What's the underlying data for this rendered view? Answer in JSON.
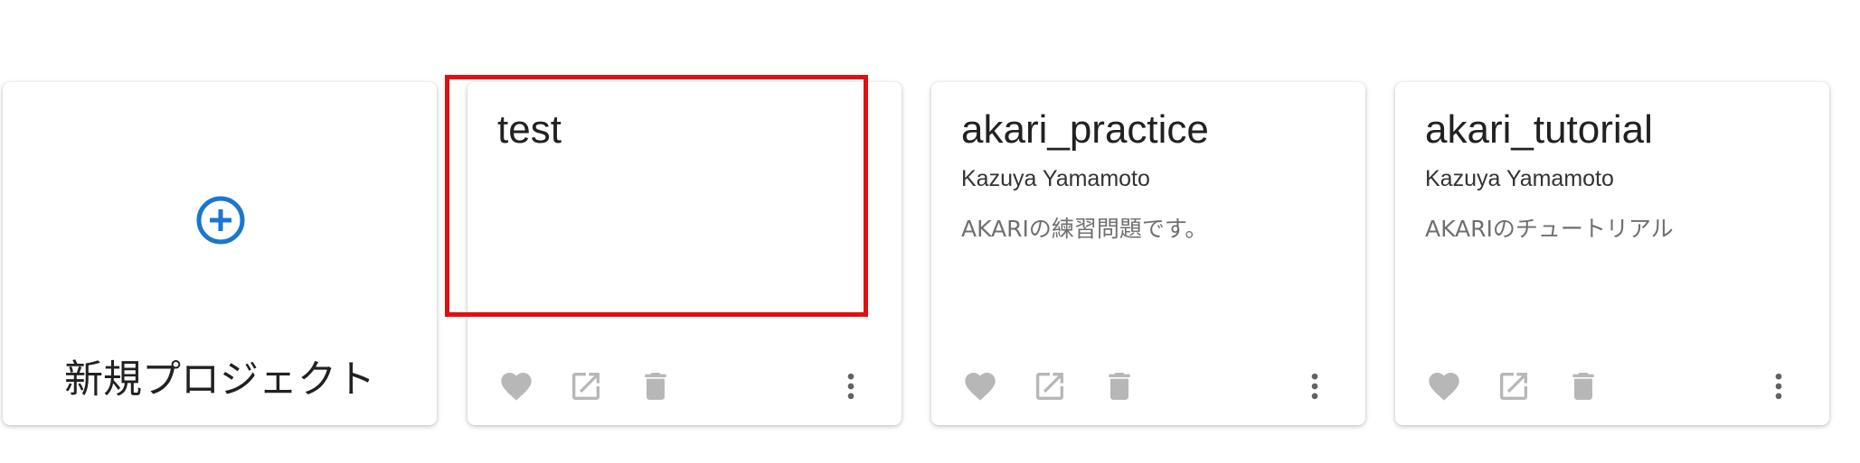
{
  "new_project": {
    "label": "新規プロジェクト",
    "icon": "add-circle-icon",
    "accent": "#1976d2"
  },
  "projects": [
    {
      "title": "test",
      "author": "",
      "description": ""
    },
    {
      "title": "akari_practice",
      "author": "Kazuya Yamamoto",
      "description": "AKARIの練習問題です。"
    },
    {
      "title": "akari_tutorial",
      "author": "Kazuya Yamamoto",
      "description": "AKARIのチュートリアル"
    }
  ],
  "actions": {
    "icons": [
      "heart-icon",
      "open-in-new-icon",
      "trash-icon",
      "more-vertical-icon"
    ],
    "icon_color": "#b7b7b7",
    "more_color": "#616161"
  },
  "highlight": {
    "color": "#e01010"
  }
}
